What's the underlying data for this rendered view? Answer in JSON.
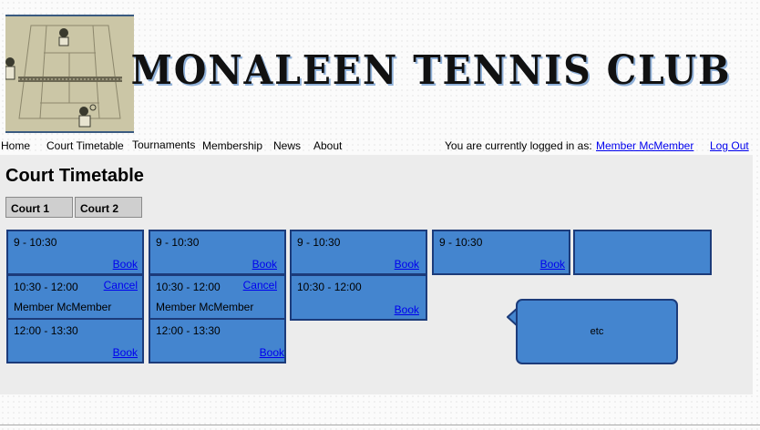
{
  "header": {
    "title": "MONALEEN TENNIS CLUB"
  },
  "nav": {
    "items": [
      "Home",
      "Court Timetable",
      "Tournaments",
      "Membership",
      "News",
      "About"
    ]
  },
  "user": {
    "logged_in_label": "You are currently logged in as:",
    "name": "Member McMember",
    "logout": "Log Out"
  },
  "page": {
    "title": "Court Timetable"
  },
  "tabs": [
    "Court 1",
    "Court 2"
  ],
  "slots": {
    "c1": {
      "t1": "9 - 10:30",
      "t2": "10:30 - 12:00",
      "t3": "12:00 - 13:30",
      "member": "Member McMember",
      "book": "Book",
      "cancel": "Cancel"
    },
    "c2": {
      "t1": "9 - 10:30",
      "t2": "10:30 - 12:00",
      "t3": "12:00 - 13:30",
      "member": "Member McMember",
      "book": "Book",
      "cancel": "Cancel"
    },
    "c3": {
      "t1": "9 - 10:30",
      "t2": "10:30 - 12:00",
      "book": "Book"
    },
    "c4": {
      "t1": "9 - 10:30",
      "book": "Book"
    }
  },
  "bubble": {
    "text": "etc"
  },
  "colors": {
    "slot": "#4485cf",
    "slot_border": "#1c3b7a",
    "main_bg": "#ececec",
    "link": "#0000ee"
  }
}
